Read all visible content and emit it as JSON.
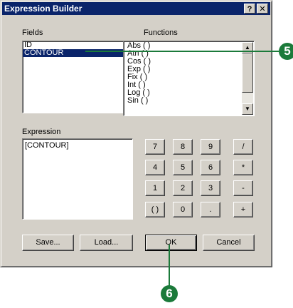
{
  "dialog": {
    "title": "Expression Builder",
    "help_glyph": "?",
    "close_glyph": "✕"
  },
  "fields": {
    "label": "Fields",
    "items": [
      "ID",
      "CONTOUR"
    ],
    "selected": "CONTOUR"
  },
  "functions": {
    "label": "Functions",
    "items": [
      "Abs ( )",
      "Atn ( )",
      "Cos ( )",
      "Exp ( )",
      "Fix ( )",
      "Int ( )",
      "Log ( )",
      "Sin ( )"
    ]
  },
  "expression": {
    "label": "Expression",
    "value": "[CONTOUR]"
  },
  "keypad": {
    "rows": [
      [
        "7",
        "8",
        "9",
        "/"
      ],
      [
        "4",
        "5",
        "6",
        "*"
      ],
      [
        "1",
        "2",
        "3",
        "-"
      ],
      [
        "( )",
        "0",
        ".",
        "+"
      ]
    ]
  },
  "buttons": {
    "save": "Save...",
    "load": "Load...",
    "ok": "OK",
    "cancel": "Cancel"
  },
  "callouts": {
    "step5": "5",
    "step6": "6"
  },
  "colors": {
    "title_bar": "#0a246a",
    "selection": "#0a246a",
    "callout": "#1b7a3a",
    "dialog_bg": "#d4d0c8"
  }
}
